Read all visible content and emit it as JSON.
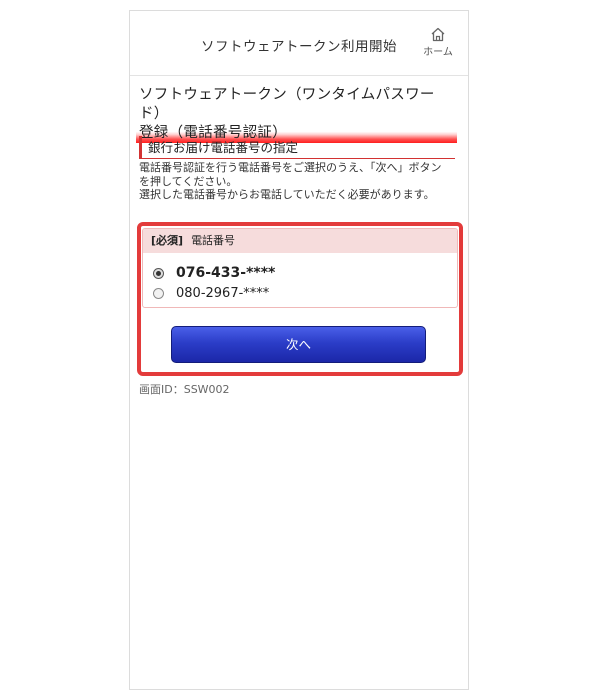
{
  "header": {
    "title": "ソフトウェアトークン利用開始",
    "home_label": "ホーム"
  },
  "page": {
    "heading_line1": "ソフトウェアトークン（ワンタイムパスワード）",
    "heading_line2": "登録（電話番号認証）",
    "section_heading": "銀行お届け電話番号の指定",
    "description": [
      "電話番号認証を行う電話番号をご選択のうえ、「次へ」ボタン",
      "を押してください。",
      "選択した電話番号からお電話していただく必要があります。"
    ]
  },
  "form": {
    "required_tag": "[必須]",
    "field_label": "電話番号",
    "options": [
      {
        "label": "076-433-****",
        "selected": true
      },
      {
        "label": "080-2967-****",
        "selected": false
      }
    ],
    "next_button": "次へ"
  },
  "footer": {
    "screen_id": "画面ID：SSW002"
  },
  "colors": {
    "accent_red": "#e33b3b",
    "button_blue": "#2b3dc8"
  }
}
